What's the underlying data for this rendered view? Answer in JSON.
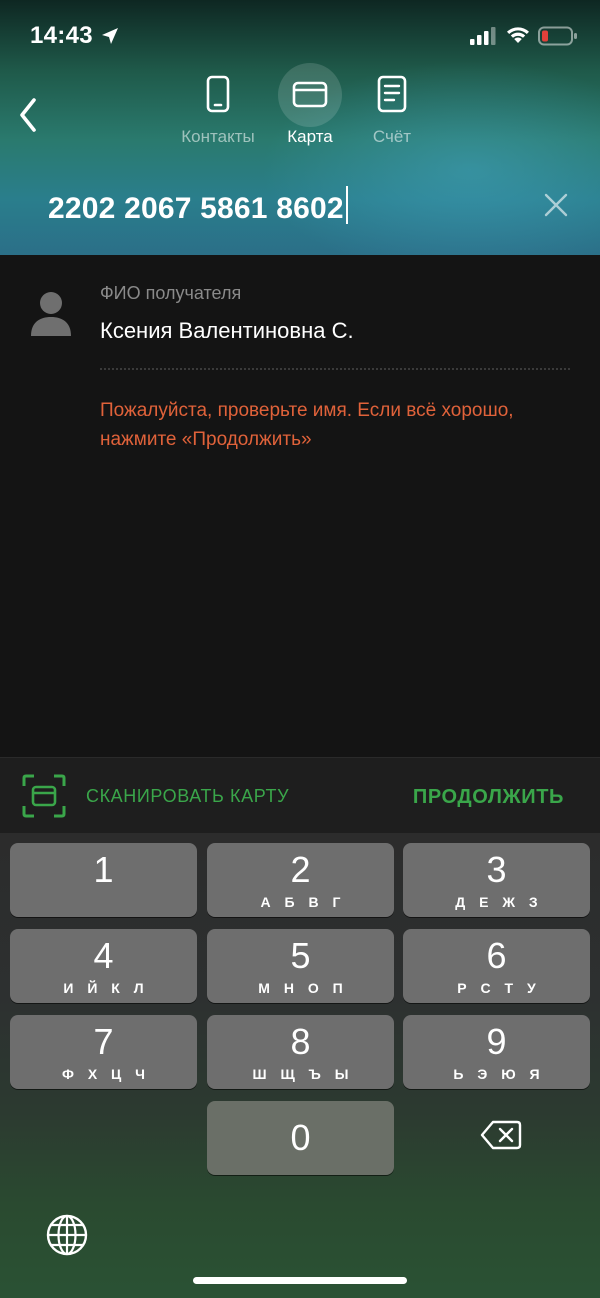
{
  "status_bar": {
    "time": "14:43"
  },
  "tabs": [
    {
      "label": "Контакты",
      "active": false
    },
    {
      "label": "Карта",
      "active": true
    },
    {
      "label": "Счёт",
      "active": false
    }
  ],
  "card_number": {
    "value": "2202 2067 5861 8602"
  },
  "recipient": {
    "label": "ФИО получателя",
    "name": "Ксения Валентиновна С.",
    "warning": "Пожалуйста, проверьте имя. Если всё хорошо, нажмите «Продолжить»"
  },
  "actions": {
    "scan_label": "СКАНИРОВАТЬ КАРТУ",
    "continue_label": "ПРОДОЛЖИТЬ"
  },
  "keypad": {
    "keys": [
      {
        "digit": "1",
        "letters": ""
      },
      {
        "digit": "2",
        "letters": "А Б В Г"
      },
      {
        "digit": "3",
        "letters": "Д Е Ж З"
      },
      {
        "digit": "4",
        "letters": "И Й К Л"
      },
      {
        "digit": "5",
        "letters": "М Н О П"
      },
      {
        "digit": "6",
        "letters": "Р С Т У"
      },
      {
        "digit": "7",
        "letters": "Ф Х Ц Ч"
      },
      {
        "digit": "8",
        "letters": "Ш Щ Ъ Ы"
      },
      {
        "digit": "9",
        "letters": "Ь Э Ю Я"
      },
      {
        "digit": "0",
        "letters": ""
      }
    ]
  },
  "colors": {
    "accent_green": "#3aa64a",
    "warning_orange": "#e0623a",
    "key_gray": "#6e6e6e"
  },
  "icons": {
    "back": "chevron-left-icon",
    "contacts_tab": "phone-icon",
    "card_tab": "credit-card-icon",
    "account_tab": "document-icon",
    "clear": "close-icon",
    "avatar": "person-icon",
    "scan": "scan-card-icon",
    "backspace": "backspace-icon",
    "globe": "globe-icon"
  }
}
